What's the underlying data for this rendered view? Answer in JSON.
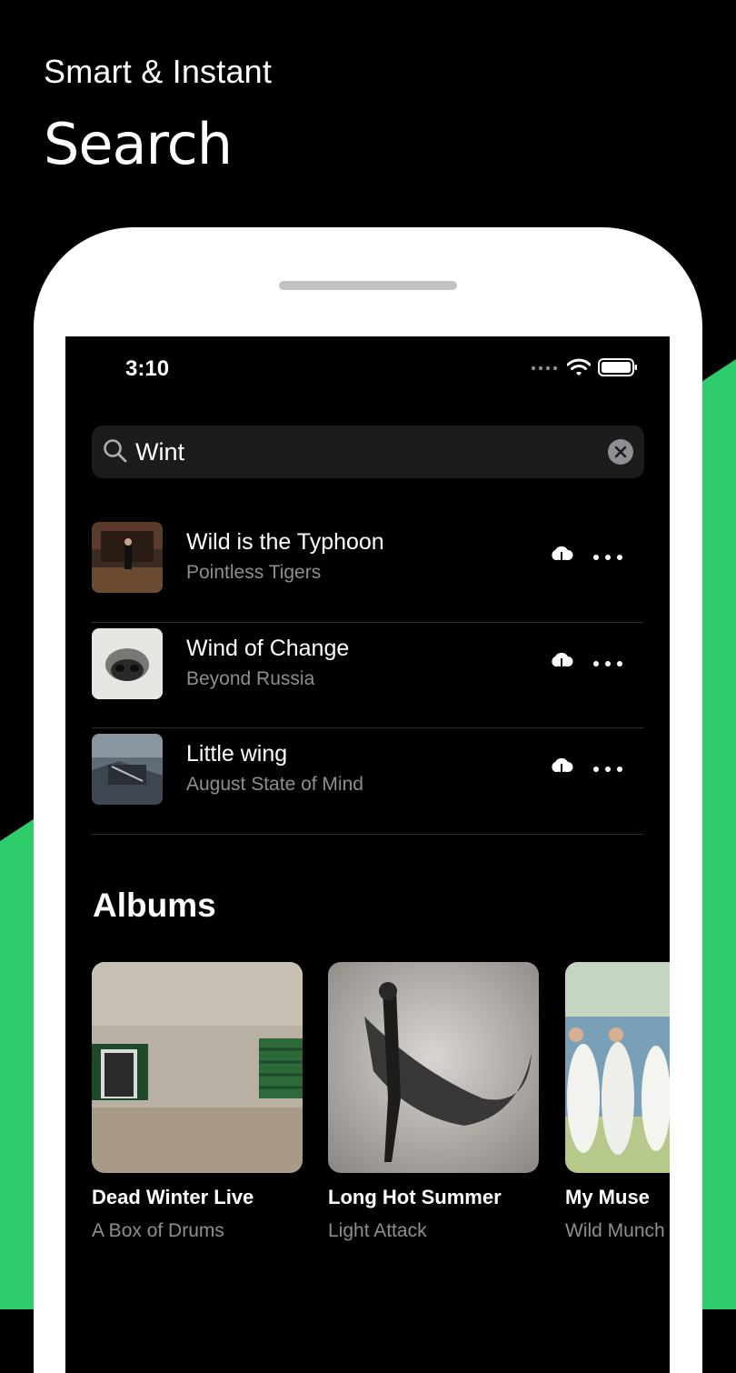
{
  "promo": {
    "line1": "Smart & Instant",
    "line2": "Search"
  },
  "colors": {
    "accent": "#2ecc6a",
    "background": "#000000",
    "secondary_text": "#8e8e93"
  },
  "status_bar": {
    "time": "3:10",
    "icons": [
      "signal-icon",
      "wifi-icon",
      "battery-icon"
    ]
  },
  "search": {
    "value": "Wint"
  },
  "tracks": [
    {
      "title": "Wild is the Typhoon",
      "artist": "Pointless Tigers"
    },
    {
      "title": "Wind of Change",
      "artist": "Beyond Russia"
    },
    {
      "title": "Little wing",
      "artist": "August State of Mind"
    }
  ],
  "albums_heading": "Albums",
  "albums": [
    {
      "title": "Dead Winter Live",
      "artist": "A Box of Drums"
    },
    {
      "title": "Long Hot Summer",
      "artist": "Light Attack"
    },
    {
      "title": "My Muse",
      "artist": "Wild Munch"
    }
  ]
}
